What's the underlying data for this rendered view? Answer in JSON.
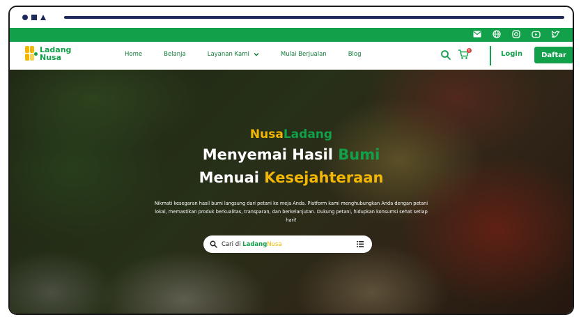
{
  "nav": {
    "logo": {
      "line1": "Ladang",
      "line2": "Nusa"
    },
    "menu": [
      {
        "label": "Home"
      },
      {
        "label": "Belanja"
      },
      {
        "label": "Layanan Kami"
      },
      {
        "label": "Mulai Berjualan"
      },
      {
        "label": "Blog"
      }
    ],
    "cart_badge": "0",
    "login_label": "Login",
    "signup_label": "Daftar"
  },
  "social_icons": [
    "mail-icon",
    "globe-icon",
    "instagram-icon",
    "youtube-icon",
    "twitter-icon"
  ],
  "hero": {
    "brand_part1": "Nusa",
    "brand_part2": "Ladang",
    "headline1_main": "Menyemai Hasil ",
    "headline1_highlight": "Bumi",
    "headline2_main": "Menuai ",
    "headline2_highlight": "Kesejahteraan",
    "description": "Nikmati kesegaran hasil bumi langsung dari petani ke meja Anda. Platform kami menghubungkan Anda dengan petani lokal, memastikan produk berkualitas, transparan, dan berkelanjutan. Dukung petani, hidupkan konsumsi sehat setiap hari!",
    "search": {
      "prefix": "Cari di ",
      "brand_a": "Ladang",
      "brand_b": "Nusa"
    }
  },
  "colors": {
    "brand_green": "#12a04a",
    "brand_yellow": "#f2b705",
    "chrome_navy": "#1e2a5a"
  }
}
